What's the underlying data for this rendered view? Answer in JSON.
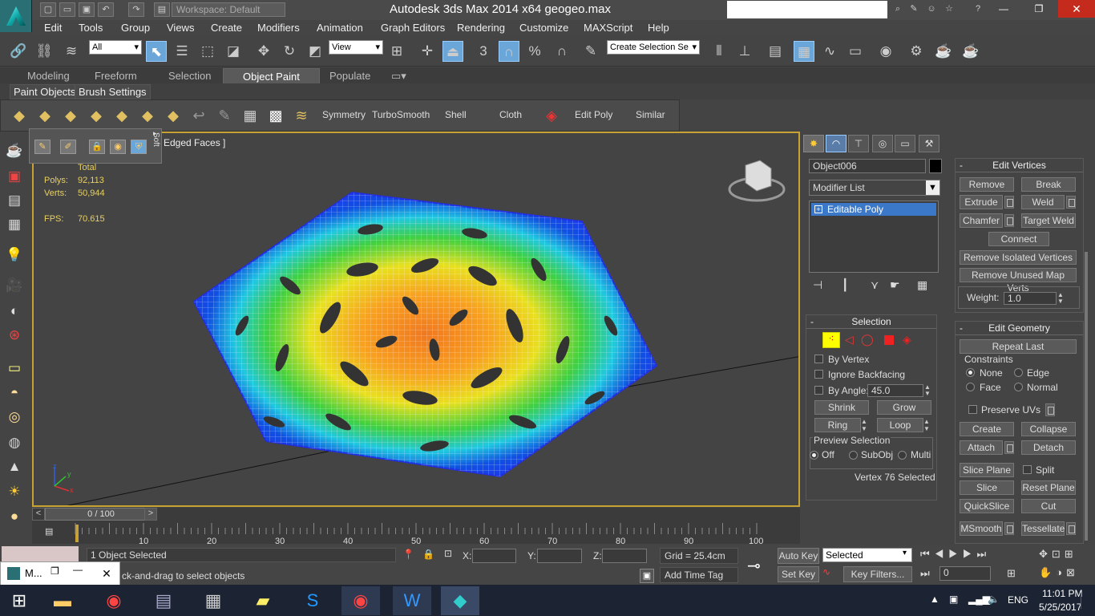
{
  "titlebar": {
    "title": "Autodesk 3ds Max  2014 x64      geogeo.max",
    "workspace": "Workspace: Default",
    "minimize": "—",
    "maximize": "❐",
    "close": "✕"
  },
  "menu": [
    "Edit",
    "Tools",
    "Group",
    "Views",
    "Create",
    "Modifiers",
    "Animation",
    "Graph Editors",
    "Rendering",
    "Customize",
    "MAXScript",
    "Help"
  ],
  "toolbar": {
    "filter_select": "All",
    "ref_coord": "View",
    "named_sel": "Create Selection Se"
  },
  "ribbon": {
    "tabs": [
      "Modeling",
      "Freeform",
      "Selection",
      "Object Paint",
      "Populate"
    ],
    "active_tab": "Object Paint",
    "subtabs": [
      "Paint Objects",
      "Brush Settings"
    ],
    "tools": [
      "Symmetry",
      "TurboSmooth",
      "Shell",
      "Cloth",
      "Edit Poly",
      "Similar"
    ]
  },
  "popup": {
    "label": "Soft"
  },
  "viewport": {
    "label": "Edged Faces ]",
    "stats": {
      "total_label": "Total",
      "polys_label": "Polys:",
      "polys_value": "92,113",
      "verts_label": "Verts:",
      "verts_value": "50,944",
      "fps_label": "FPS:",
      "fps_value": "70.615"
    },
    "axis": {
      "x": "x",
      "y": "y",
      "z": "z"
    }
  },
  "command_panel": {
    "object_name": "Object006",
    "modifier_list": "Modifier List",
    "stack_item": "Editable Poly",
    "edit_vertices": {
      "title": "Edit Vertices",
      "remove": "Remove",
      "break": "Break",
      "extrude": "Extrude",
      "weld": "Weld",
      "chamfer": "Chamfer",
      "target_weld": "Target Weld",
      "connect": "Connect",
      "remove_isolated": "Remove Isolated Vertices",
      "remove_unused": "Remove Unused Map Verts",
      "weight_label": "Weight:",
      "weight_value": "1.0"
    },
    "edit_geometry": {
      "title": "Edit Geometry",
      "repeat_last": "Repeat Last",
      "constraints_label": "Constraints",
      "none": "None",
      "edge": "Edge",
      "face": "Face",
      "normal": "Normal",
      "preserve_uvs": "Preserve UVs",
      "create": "Create",
      "collapse": "Collapse",
      "attach": "Attach",
      "detach": "Detach",
      "slice_plane": "Slice Plane",
      "split": "Split",
      "slice": "Slice",
      "reset_plane": "Reset Plane",
      "quickslice": "QuickSlice",
      "cut": "Cut",
      "msmooth": "MSmooth",
      "tessellate": "Tessellate"
    },
    "selection": {
      "title": "Selection",
      "by_vertex": "By Vertex",
      "ignore_backfacing": "Ignore Backfacing",
      "by_angle": "By Angle:",
      "angle_value": "45.0",
      "shrink": "Shrink",
      "grow": "Grow",
      "ring": "Ring",
      "loop": "Loop",
      "preview_label": "Preview Selection",
      "off": "Off",
      "subobj": "SubObj",
      "multi": "Multi",
      "status": "Vertex 76 Selected"
    }
  },
  "timeline": {
    "frame": "0 / 100",
    "ticks": [
      "10",
      "20",
      "30",
      "40",
      "50",
      "60",
      "70",
      "80",
      "90",
      "100"
    ]
  },
  "status": {
    "objects_selected": "1 Object Selected",
    "prompt": "ck-and-drag to select objects",
    "x_label": "X:",
    "y_label": "Y:",
    "z_label": "Z:",
    "grid": "Grid = 25.4cm",
    "add_time_tag": "Add Time Tag",
    "auto_key": "Auto Key",
    "set_key": "Set Key",
    "selected": "Selected",
    "key_filters": "Key Filters...",
    "frame_field": "0"
  },
  "maxthumb": {
    "label": "M..."
  },
  "taskbar": {
    "time": "11:01 PM",
    "date": "5/25/2017",
    "lang": "ENG"
  },
  "colors": {
    "viewport_border": "#c8a232",
    "stack_highlight": "#3c78c8",
    "accent_yellow": "#ffff00"
  }
}
